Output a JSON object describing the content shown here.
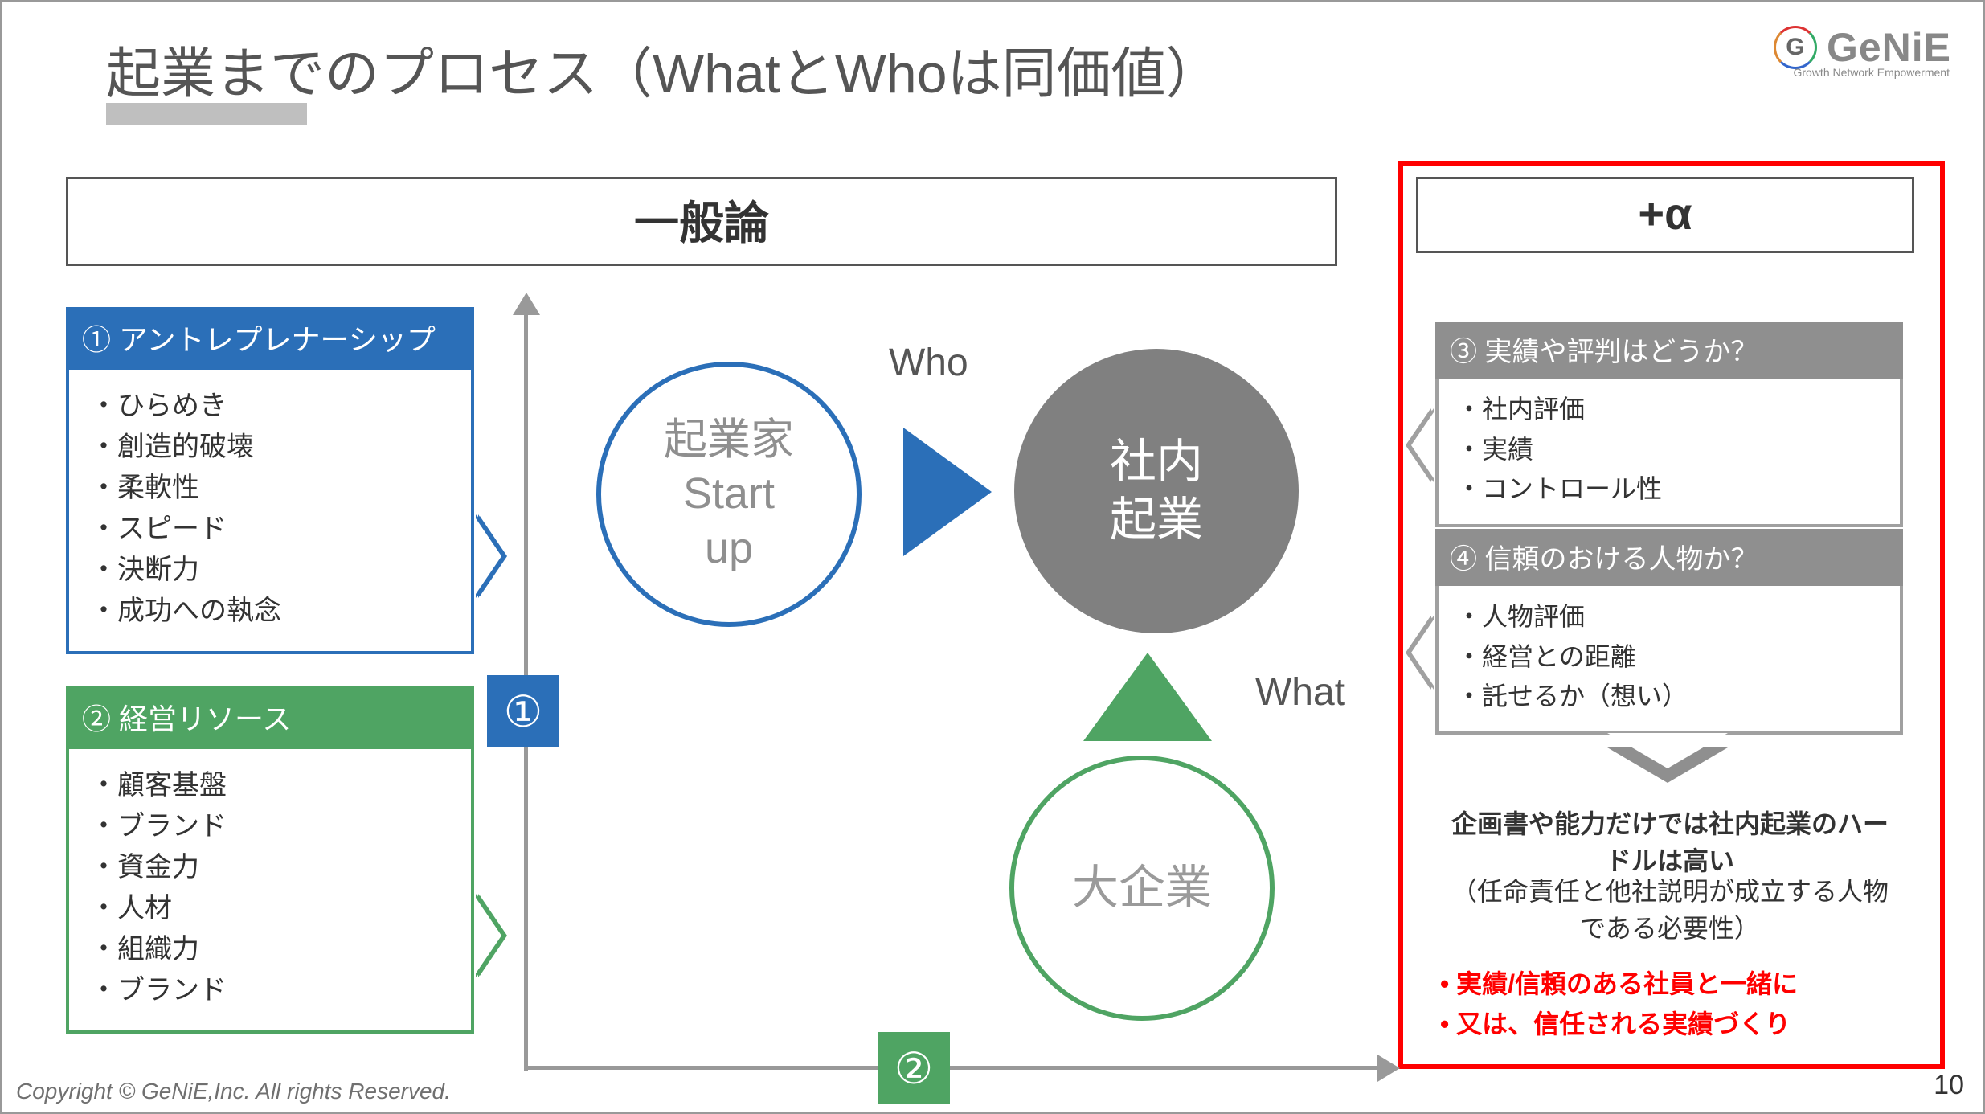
{
  "title": "起業までのプロセス（WhatとWhoは同価値）",
  "logo": {
    "mark": "G",
    "text": "GeNiE",
    "sub": "Growth Network Empowerment"
  },
  "sections": {
    "general": "一般論",
    "alpha": "+α"
  },
  "left": {
    "card1": {
      "head": "① アントレプレナーシップ",
      "items": [
        "ひらめき",
        "創造的破壊",
        "柔軟性",
        "スピード",
        "決断力",
        "成功への執念"
      ]
    },
    "card2": {
      "head": "② 経営リソース",
      "items": [
        "顧客基盤",
        "ブランド",
        "資金力",
        "人材",
        "組織力",
        "ブランド"
      ]
    }
  },
  "axisBadges": {
    "one": "①",
    "two": "②"
  },
  "circles": {
    "startup": "起業家\nStart\nup",
    "internal": "社内\n起業",
    "big": "大企業"
  },
  "labels": {
    "who": "Who",
    "what": "What"
  },
  "right": {
    "card3": {
      "head": "③ 実績や評判はどうか？",
      "items": [
        "社内評価",
        "実績",
        "コントロール性"
      ]
    },
    "card4": {
      "head": "④ 信頼のおける人物か？",
      "items": [
        "人物評価",
        "経営との距離",
        "託せるか（想い）"
      ]
    },
    "text1": "企画書や能力だけでは社内起業のハードルは高い",
    "text2": "（任命責任と他社説明が成立する人物である必要性）",
    "red": [
      "実績/信頼のある社員と一緒に",
      "又は、信任される実績づくり"
    ]
  },
  "footer": "Copyright © GeNiE,Inc. All rights Reserved.",
  "page": "10"
}
